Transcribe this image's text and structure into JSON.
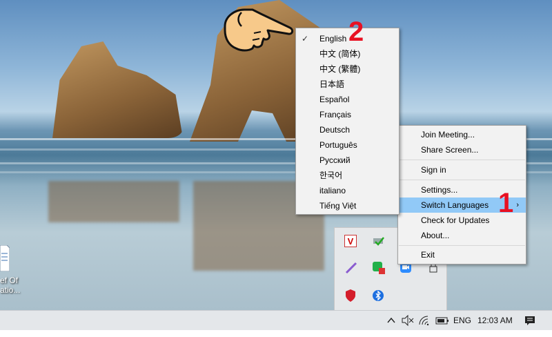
{
  "context_menu": {
    "items": [
      {
        "label": "Join Meeting..."
      },
      {
        "label": "Share Screen..."
      },
      {
        "label": "Sign in"
      },
      {
        "label": "Settings..."
      },
      {
        "label": "Switch Languages"
      },
      {
        "label": "Check for Updates"
      },
      {
        "label": "About..."
      },
      {
        "label": "Exit"
      }
    ]
  },
  "language_menu": {
    "selected": "English",
    "items": [
      {
        "label": "English"
      },
      {
        "label": "中文 (简体)"
      },
      {
        "label": "中文 (繁體)"
      },
      {
        "label": "日本語"
      },
      {
        "label": "Español"
      },
      {
        "label": "Français"
      },
      {
        "label": "Deutsch"
      },
      {
        "label": "Português"
      },
      {
        "label": "Русский"
      },
      {
        "label": "한국어"
      },
      {
        "label": "italiano"
      },
      {
        "label": "Tiếng Việt"
      }
    ]
  },
  "annotations": {
    "step1": "1",
    "step2": "2"
  },
  "taskbar": {
    "language": "ENG",
    "time": "12:03 AM"
  },
  "desktop_icon": {
    "label_line1": "ef Of",
    "label_line2": "atio..."
  },
  "colors": {
    "highlight": "#91c9f7",
    "annotation_red": "#e81123",
    "menu_bg": "#f2f2f2"
  }
}
